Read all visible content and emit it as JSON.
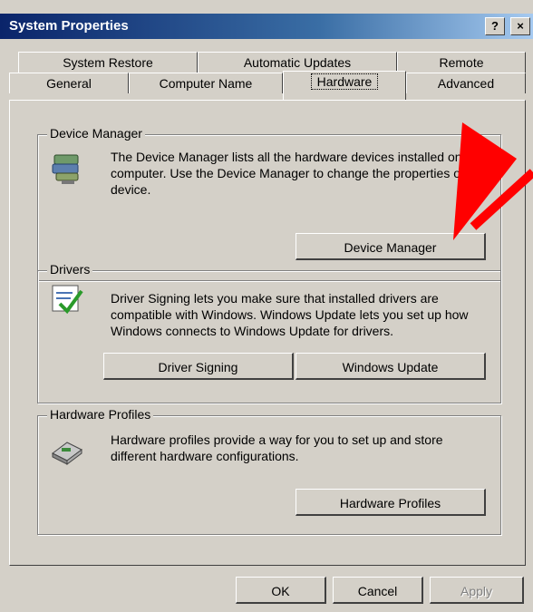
{
  "window": {
    "title": "System Properties",
    "help_label": "?",
    "close_label": "×"
  },
  "tabs": {
    "row1": [
      "System Restore",
      "Automatic Updates",
      "Remote"
    ],
    "row2": [
      "General",
      "Computer Name",
      "Hardware",
      "Advanced"
    ],
    "active": "Hardware"
  },
  "device_manager": {
    "legend": "Device Manager",
    "description": "The Device Manager lists all the hardware devices installed on your computer. Use the Device Manager to change the properties of any device.",
    "button_label": "Device Manager",
    "icon": "device-manager-icon"
  },
  "drivers": {
    "legend": "Drivers",
    "description": "Driver Signing lets you make sure that installed drivers are compatible with Windows. Windows Update lets you set up how Windows connects to Windows Update for drivers.",
    "driver_signing_label": "Driver Signing",
    "windows_update_label": "Windows Update",
    "icon": "driver-signing-icon"
  },
  "hardware_profiles": {
    "legend": "Hardware Profiles",
    "description": "Hardware profiles provide a way for you to set up and store different hardware configurations.",
    "button_label": "Hardware Profiles",
    "icon": "hardware-profiles-icon"
  },
  "footer": {
    "ok_label": "OK",
    "cancel_label": "Cancel",
    "apply_label": "Apply"
  },
  "colors": {
    "titlebar": "#0a246a",
    "face": "#d4d0c8",
    "annotation_arrow": "#ff0000"
  }
}
